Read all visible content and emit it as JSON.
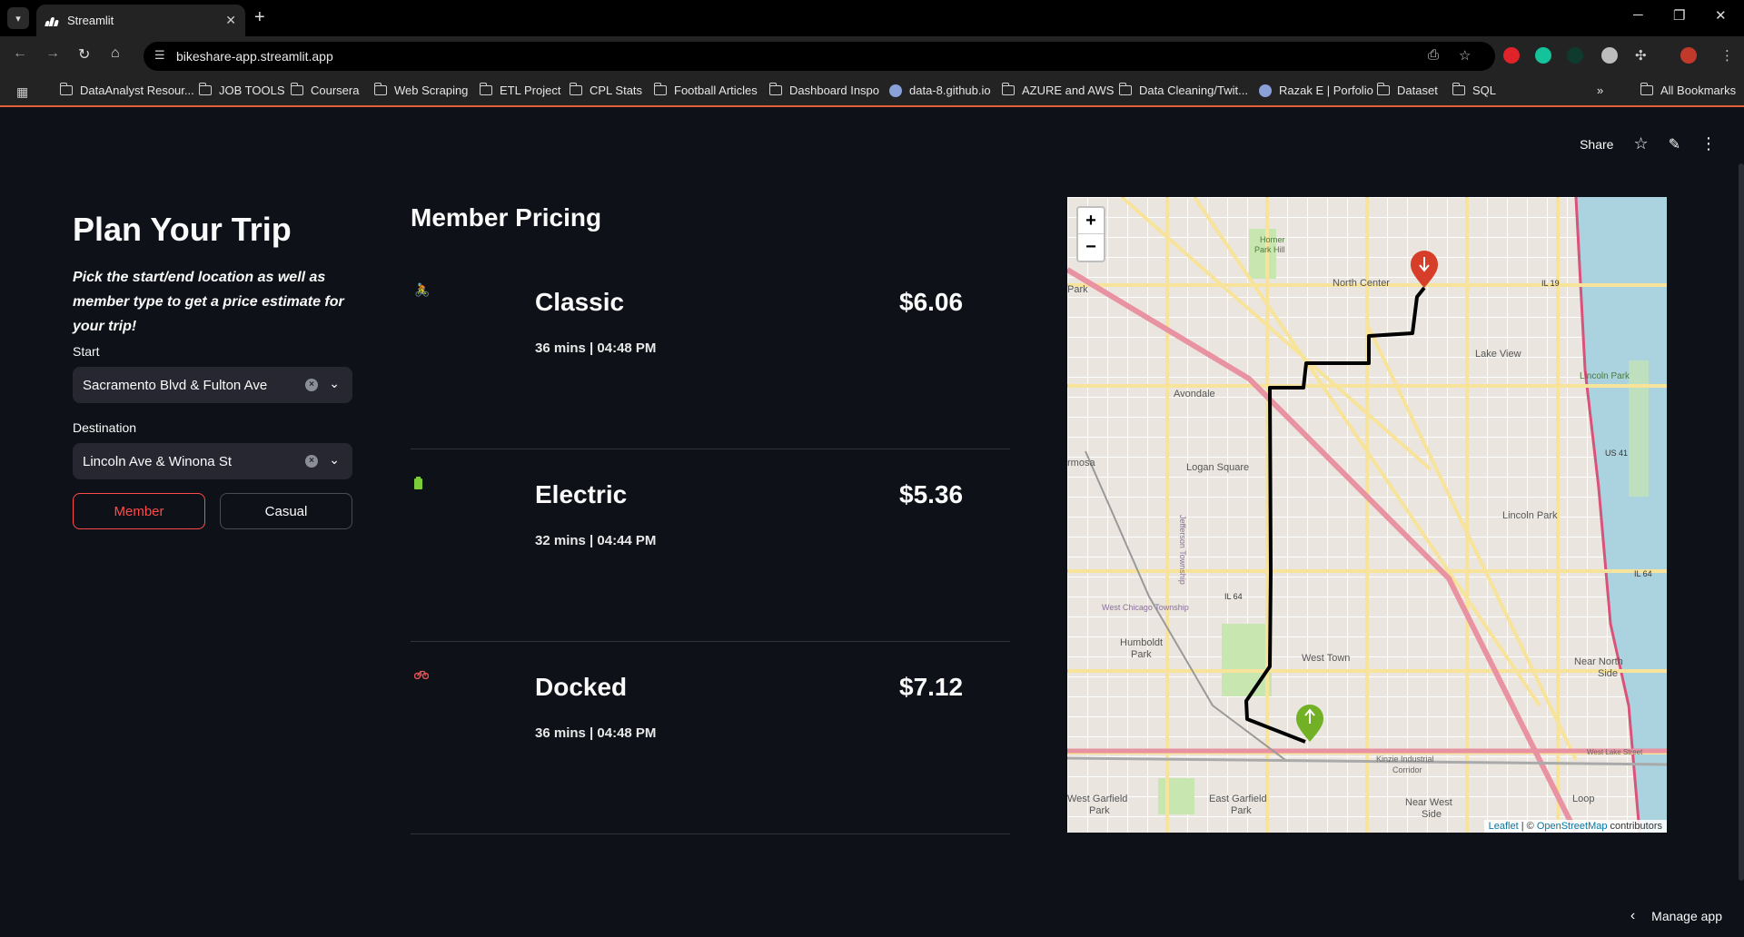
{
  "browser": {
    "tab_title": "Streamlit",
    "url": "bikeshare-app.streamlit.app",
    "bookmarks": [
      {
        "label": "DataAnalyst Resour...",
        "icon": "folder-icon"
      },
      {
        "label": "JOB TOOLS",
        "icon": "folder-icon"
      },
      {
        "label": "Coursera",
        "icon": "folder-icon"
      },
      {
        "label": "Web Scraping",
        "icon": "folder-icon"
      },
      {
        "label": "ETL Project",
        "icon": "folder-icon"
      },
      {
        "label": "CPL Stats",
        "icon": "folder-icon"
      },
      {
        "label": "Football Articles",
        "icon": "folder-icon"
      },
      {
        "label": "Dashboard Inspo",
        "icon": "folder-icon"
      },
      {
        "label": "data-8.github.io",
        "icon": "globe-icon"
      },
      {
        "label": "AZURE and AWS",
        "icon": "folder-icon"
      },
      {
        "label": "Data Cleaning/Twit...",
        "icon": "folder-icon"
      },
      {
        "label": "Razak E | Porfolio",
        "icon": "globe-icon"
      },
      {
        "label": "Dataset",
        "icon": "folder-icon"
      },
      {
        "label": "SQL",
        "icon": "folder-icon"
      }
    ],
    "more_bookmarks": "»",
    "all_bookmarks": "All Bookmarks"
  },
  "header": {
    "share_label": "Share"
  },
  "trip": {
    "title": "Plan Your Trip",
    "subtitle": "Pick the start/end location as well as member type to get a price estimate for your trip!",
    "start_label": "Start",
    "start_value": "Sacramento Blvd & Fulton Ave",
    "destination_label": "Destination",
    "destination_value": "Lincoln Ave & Winona St",
    "member_button": "Member",
    "casual_button": "Casual"
  },
  "pricing": {
    "title": "Member Pricing",
    "options": [
      {
        "name": "Classic",
        "price": "$6.06",
        "meta": "36 mins | 04:48 PM",
        "icon": "bicyclist-icon"
      },
      {
        "name": "Electric",
        "price": "$5.36",
        "meta": "32 mins | 04:44 PM",
        "icon": "battery-icon"
      },
      {
        "name": "Docked",
        "price": "$7.12",
        "meta": "36 mins | 04:48 PM",
        "icon": "bicycle-icon"
      }
    ]
  },
  "map": {
    "zoom_in": "+",
    "zoom_out": "−",
    "labels": [
      "North Center",
      "Lake View",
      "Avondale",
      "Logan Square",
      "Lincoln Park",
      "Humboldt Park",
      "West Town",
      "Near North Side",
      "East Garfield Park",
      "West Garfield Park",
      "Near West Side",
      "Loop",
      "Horner Park Hill",
      "Kinzie Industrial Corridor",
      "West Chicago Township",
      "Jefferson Township",
      "Park",
      "rmosa",
      "IL 19",
      "US 41",
      "IL 64",
      "West Lake Street",
      "Lincoln Park"
    ],
    "attribution_leaflet": "Leaflet",
    "attribution_sep": " | © ",
    "attribution_osm": "OpenStreetMap",
    "attribution_tail": " contributors"
  },
  "footer": {
    "manage_app": "Manage app"
  }
}
